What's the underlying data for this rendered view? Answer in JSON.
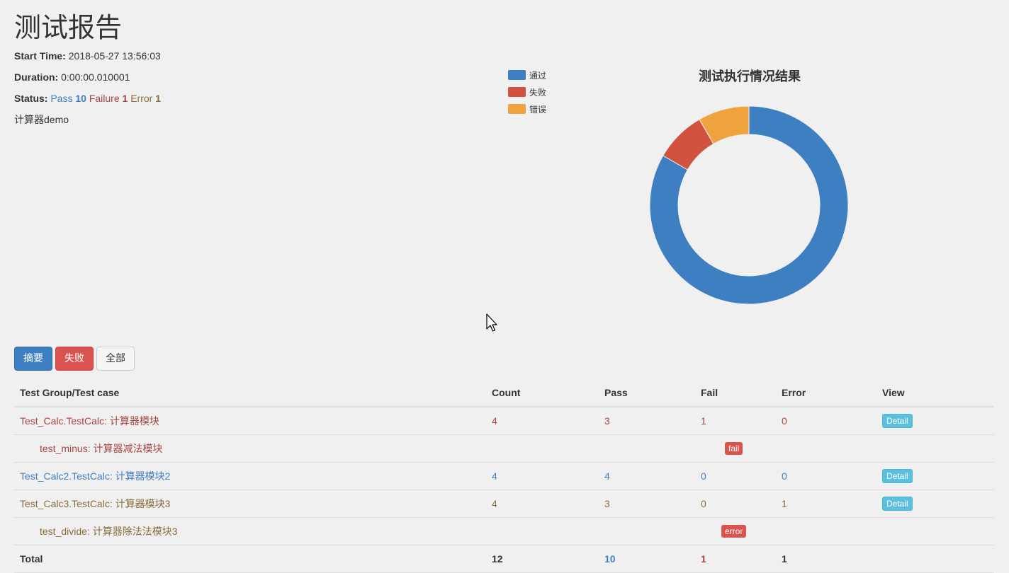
{
  "report": {
    "title": "测试报告",
    "start_time_label": "Start Time:",
    "start_time": "2018-05-27 13:56:03",
    "duration_label": "Duration:",
    "duration": "0:00:00.010001",
    "status_label": "Status:",
    "status_pass_label": "Pass",
    "status_pass": "10",
    "status_failure_label": "Failure",
    "status_failure": "1",
    "status_error_label": "Error",
    "status_error": "1",
    "description": "计算器demo"
  },
  "chart": {
    "title": "测试执行情况结果",
    "legend": [
      {
        "label": "通过",
        "color": "#3e7fc1"
      },
      {
        "label": "失败",
        "color": "#d25240"
      },
      {
        "label": "错误",
        "color": "#f0a23f"
      }
    ]
  },
  "chart_data": {
    "type": "pie",
    "title": "测试执行情况结果",
    "categories": [
      "通过",
      "失败",
      "错误"
    ],
    "values": [
      10,
      1,
      1
    ],
    "colors": [
      "#3e7fc1",
      "#d25240",
      "#f0a23f"
    ],
    "legend_position": "top-left"
  },
  "filters": {
    "summary": "摘要",
    "failed": "失败",
    "all": "全部"
  },
  "table": {
    "headers": [
      "Test Group/Test case",
      "Count",
      "Pass",
      "Fail",
      "Error",
      "View"
    ],
    "rows": [
      {
        "name": "Test_Calc.TestCalc: 计算器模块",
        "count": "4",
        "pass": "3",
        "fail": "1",
        "error": "0",
        "view": "Detail"
      },
      {
        "name": "test_minus: 计算器减法模块",
        "status": "fail"
      },
      {
        "name": "Test_Calc2.TestCalc: 计算器模块2",
        "count": "4",
        "pass": "4",
        "fail": "0",
        "error": "0",
        "view": "Detail"
      },
      {
        "name": "Test_Calc3.TestCalc: 计算器模块3",
        "count": "4",
        "pass": "3",
        "fail": "0",
        "error": "1",
        "view": "Detail"
      },
      {
        "name": "test_divide: 计算器除法法模块3",
        "status": "error"
      }
    ],
    "total": {
      "label": "Total",
      "count": "12",
      "pass": "10",
      "fail": "1",
      "error": "1"
    }
  }
}
